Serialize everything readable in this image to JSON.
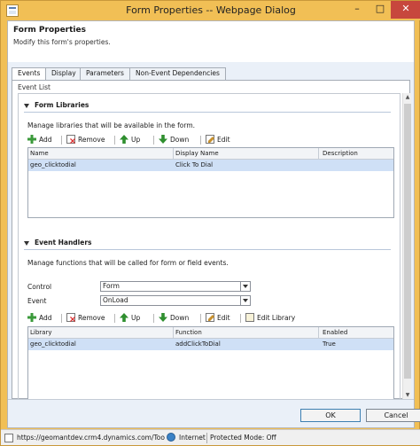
{
  "window": {
    "title": "Form Properties -- Webpage Dialog",
    "minimize": "–",
    "maximize": "□",
    "close": "✕"
  },
  "header": {
    "title": "Form Properties",
    "subtitle": "Modify this form's properties."
  },
  "tabs": [
    {
      "label": "Events",
      "active": true
    },
    {
      "label": "Display",
      "active": false
    },
    {
      "label": "Parameters",
      "active": false
    },
    {
      "label": "Non-Event Dependencies",
      "active": false
    }
  ],
  "event_list": {
    "label": "Event List",
    "form_libraries": {
      "heading": "Form Libraries",
      "description": "Manage libraries that will be available in the form.",
      "toolbar": {
        "add": "Add",
        "remove": "Remove",
        "up": "Up",
        "down": "Down",
        "edit": "Edit"
      },
      "columns": [
        "Name",
        "Display Name",
        "Description"
      ],
      "rows": [
        {
          "name": "geo_clicktodial",
          "display_name": "Click To Dial",
          "description": ""
        }
      ]
    },
    "event_handlers": {
      "heading": "Event Handlers",
      "description": "Manage functions that will be called for form or field events.",
      "control_label": "Control",
      "control_value": "Form",
      "event_label": "Event",
      "event_value": "OnLoad",
      "toolbar": {
        "add": "Add",
        "remove": "Remove",
        "up": "Up",
        "down": "Down",
        "edit": "Edit",
        "edit_library": "Edit Library"
      },
      "columns": [
        "Library",
        "Function",
        "Enabled"
      ],
      "rows": [
        {
          "library": "geo_clicktodial",
          "function": "addClickToDial",
          "enabled": "True"
        }
      ]
    }
  },
  "footer": {
    "ok": "OK",
    "cancel": "Cancel"
  },
  "statusbar": {
    "url": "https://geomantdev.crm4.dynamics.com/Too",
    "zone": "Internet",
    "mode": "Protected Mode: Off"
  }
}
